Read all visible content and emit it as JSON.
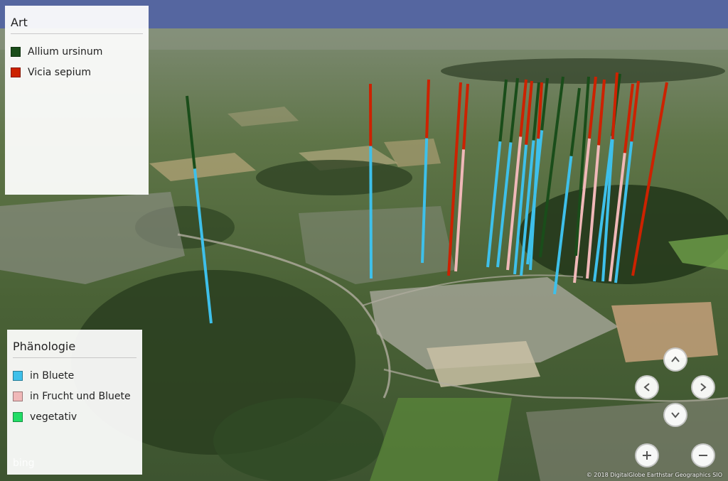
{
  "legend_art": {
    "title": "Art",
    "items": [
      {
        "label": "Allium ursinum",
        "color": "#1a4d1a"
      },
      {
        "label": "Vicia sepium",
        "color": "#cc2200"
      }
    ]
  },
  "legend_phenology": {
    "title": "Phänologie",
    "items": [
      {
        "label": "in Bluete",
        "color": "#3ec0ea"
      },
      {
        "label": "in Frucht und Bluete",
        "color": "#f0b8b8"
      },
      {
        "label": "vegetativ",
        "color": "#22dd66"
      }
    ]
  },
  "attribution": {
    "logo": "bing",
    "copyright": "© 2018 DigitalGlobe  Earthstar Geographics  SIO"
  },
  "controls": {
    "icons": [
      "chevron-up-icon",
      "chevron-left-icon",
      "chevron-right-icon",
      "chevron-down-icon",
      "plus-icon",
      "minus-icon"
    ]
  },
  "colors": {
    "sky": "#5566a0",
    "terrain": "#4f6a3c",
    "forest": "#2f4424",
    "urban": "#8c8f84"
  }
}
